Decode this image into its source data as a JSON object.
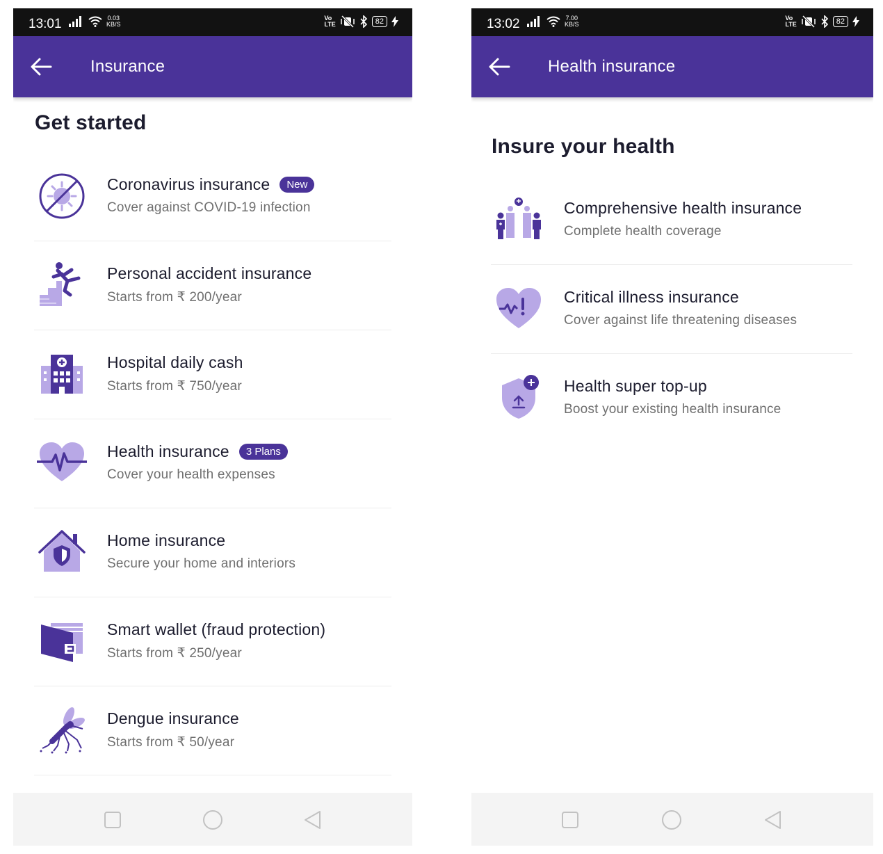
{
  "left_screen": {
    "status_bar": {
      "time": "13:01",
      "speed_top": "0.03",
      "speed_unit": "KB/S",
      "volte_top": "Vo",
      "volte_bottom": "LTE",
      "battery": "82"
    },
    "app_bar": {
      "title": "Insurance",
      "back_icon": "arrow-left-icon"
    },
    "section_title": "Get started",
    "items": [
      {
        "title": "Coronavirus insurance",
        "badge": "New",
        "subtitle": "Cover against COVID-19 infection",
        "icon": "virus-icon"
      },
      {
        "title": "Personal accident insurance",
        "subtitle": "Starts from ₹ 200/year",
        "icon": "falling-person-icon"
      },
      {
        "title": "Hospital daily cash",
        "subtitle": "Starts from ₹ 750/year",
        "icon": "hospital-icon"
      },
      {
        "title": "Health insurance",
        "badge": "3 Plans",
        "subtitle": "Cover your health expenses",
        "icon": "heart-pulse-icon"
      },
      {
        "title": "Home insurance",
        "subtitle": "Secure your home and interiors",
        "icon": "home-shield-icon"
      },
      {
        "title": "Smart wallet (fraud protection)",
        "subtitle": "Starts from ₹ 250/year",
        "icon": "wallet-icon"
      },
      {
        "title": "Dengue insurance",
        "subtitle": "Starts from ₹ 50/year",
        "icon": "mosquito-icon"
      }
    ]
  },
  "right_screen": {
    "status_bar": {
      "time": "13:02",
      "speed_top": "7.00",
      "speed_unit": "KB/S",
      "volte_top": "Vo",
      "volte_bottom": "LTE",
      "battery": "82"
    },
    "app_bar": {
      "title": "Health insurance",
      "back_icon": "arrow-left-icon"
    },
    "section_title": "Insure your health",
    "items": [
      {
        "title": "Comprehensive health insurance",
        "subtitle": "Complete health coverage",
        "icon": "family-icon"
      },
      {
        "title": "Critical illness insurance",
        "subtitle": "Cover against life threatening diseases",
        "icon": "heart-alert-icon"
      },
      {
        "title": "Health super top-up",
        "subtitle": "Boost your existing health insurance",
        "icon": "shield-plus-icon"
      }
    ]
  },
  "nav_bar": {
    "buttons": [
      "square-icon",
      "circle-icon",
      "triangle-back-icon"
    ]
  },
  "colors": {
    "primary": "#4a3399",
    "icon_light": "#b8a8e6",
    "icon_dark": "#4a3399"
  }
}
